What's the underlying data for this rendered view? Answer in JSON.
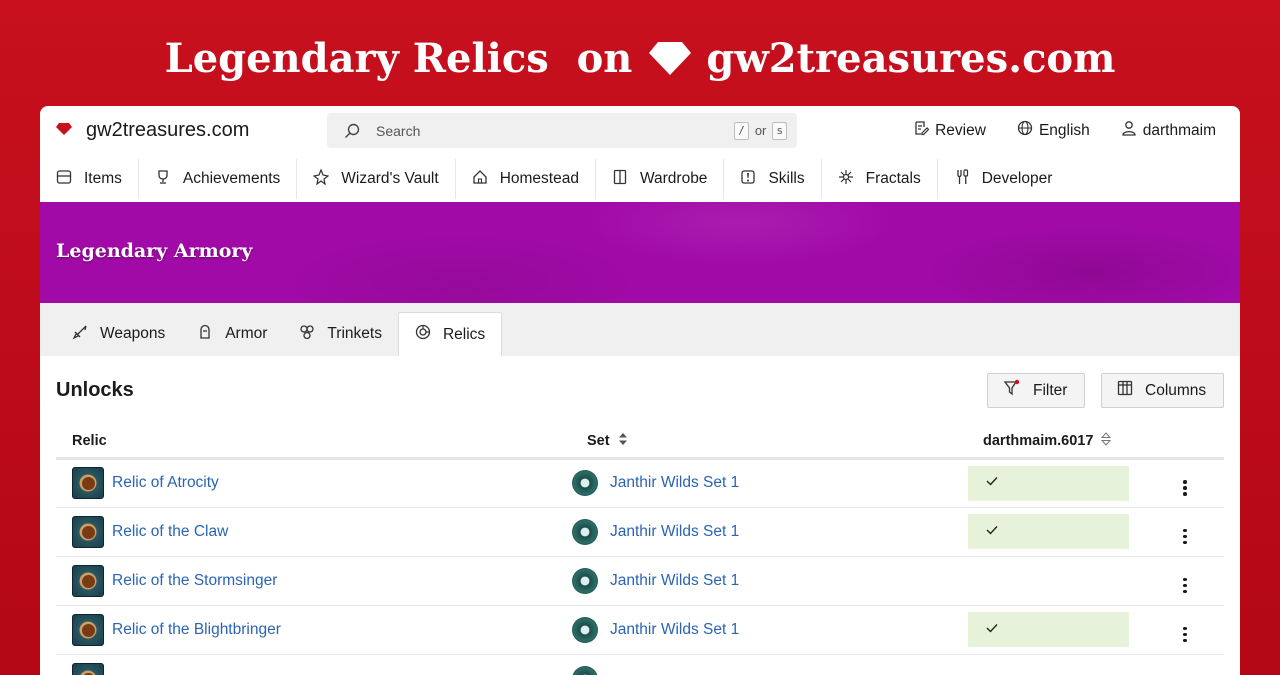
{
  "banner": {
    "text_left": "Legendary Relics  on",
    "text_right": "gw2treasures.com",
    "accent": "#c8101e"
  },
  "header": {
    "logo_text": "gw2treasures.com",
    "search": {
      "placeholder": "Search",
      "key1": "/",
      "or": "or",
      "key2": "s"
    },
    "right_nav": [
      {
        "label": "Review",
        "icon": "review-icon"
      },
      {
        "label": "English",
        "icon": "globe-icon"
      },
      {
        "label": "darthmaim",
        "icon": "user-icon"
      }
    ]
  },
  "main_nav": [
    {
      "label": "Items",
      "icon": "items-icon"
    },
    {
      "label": "Achievements",
      "icon": "trophy-icon"
    },
    {
      "label": "Wizard's Vault",
      "icon": "wizard-icon"
    },
    {
      "label": "Homestead",
      "icon": "home-icon"
    },
    {
      "label": "Wardrobe",
      "icon": "wardrobe-icon"
    },
    {
      "label": "Skills",
      "icon": "skills-icon"
    },
    {
      "label": "Fractals",
      "icon": "fractals-icon"
    },
    {
      "label": "Developer",
      "icon": "developer-icon"
    }
  ],
  "hero": {
    "title": "Legendary Armory",
    "color": "#a20aa8"
  },
  "sub_tabs": [
    {
      "label": "Weapons",
      "icon": "weapons-icon",
      "active": false
    },
    {
      "label": "Armor",
      "icon": "armor-icon",
      "active": false
    },
    {
      "label": "Trinkets",
      "icon": "trinkets-icon",
      "active": false
    },
    {
      "label": "Relics",
      "icon": "relics-icon",
      "active": true
    }
  ],
  "unlocks": {
    "title": "Unlocks",
    "filter_label": "Filter",
    "columns_label": "Columns",
    "headers": {
      "relic": "Relic",
      "set": "Set",
      "account": "darthmaim.6017"
    },
    "rows": [
      {
        "relic": "Relic of Atrocity",
        "set": "Janthir Wilds Set 1",
        "unlocked": true
      },
      {
        "relic": "Relic of the Claw",
        "set": "Janthir Wilds Set 1",
        "unlocked": true
      },
      {
        "relic": "Relic of the Stormsinger",
        "set": "Janthir Wilds Set 1",
        "unlocked": false
      },
      {
        "relic": "Relic of the Blightbringer",
        "set": "Janthir Wilds Set 1",
        "unlocked": true
      },
      {
        "relic": "",
        "set": "",
        "unlocked": false
      }
    ]
  }
}
